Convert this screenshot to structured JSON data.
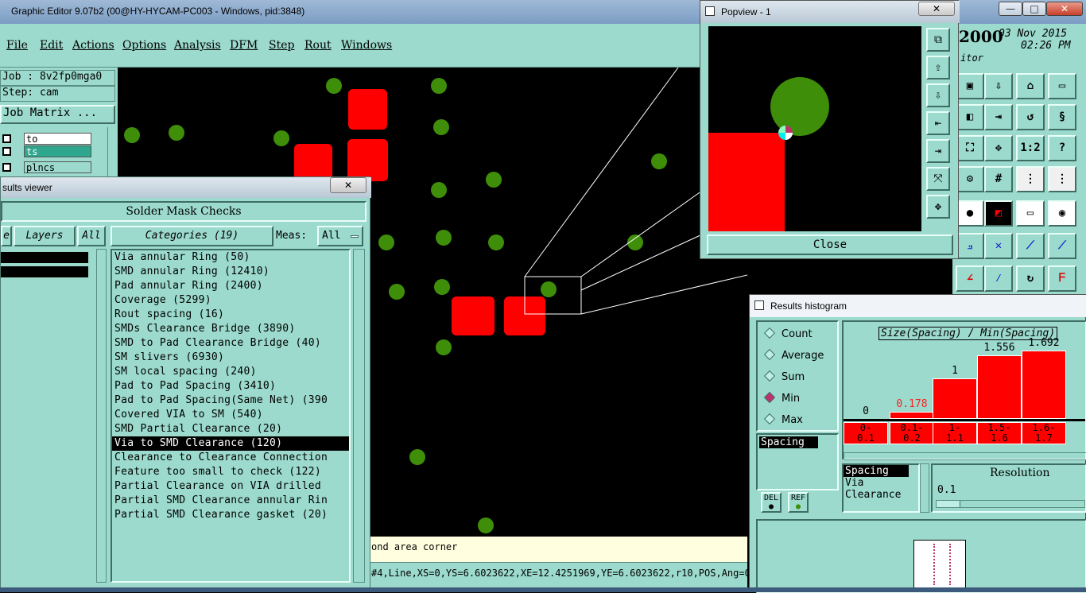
{
  "window": {
    "title": "Graphic Editor 9.07b2 (00@HY-HYCAM-PC003 - Windows, pid:3848)",
    "minimize": "—",
    "maximize": "□",
    "close": "✕"
  },
  "menu": [
    "File",
    "Edit",
    "Actions",
    "Options",
    "Analysis",
    "DFM",
    "Step",
    "Rout",
    "Windows"
  ],
  "info": {
    "job": "Job : 8v2fp0mga0",
    "step": "Step: cam",
    "job_matrix": "Job Matrix ..."
  },
  "layers": [
    "to",
    "ts",
    "plncs"
  ],
  "date_panel": {
    "year": "2000",
    "date": "03 Nov 2015",
    "time": "02:26 PM",
    "subtitle": "itor"
  },
  "results_viewer": {
    "title": "sults viewer",
    "close": "✕",
    "section_title": "Solder Mask Checks",
    "left_stub": "e",
    "layers_label": "Layers",
    "all_label": "All",
    "categories_label": "Categories (19)",
    "meas_label": "Meas:",
    "meas_value": "All",
    "categories": [
      "Via annular Ring (50)",
      "SMD annular Ring (12410)",
      "Pad annular Ring (2400)",
      "Coverage (5299)",
      "Rout spacing (16)",
      "SMDs Clearance Bridge (3890)",
      "SMD to Pad Clearance Bridge (40)",
      "SM slivers (6930)",
      "SM local spacing (240)",
      "Pad to Pad Spacing (3410)",
      "Pad to Pad Spacing(Same Net) (390",
      "Covered VIA to SM (540)",
      "SMD Partial Clearance (20)",
      "Via to SMD Clearance (120)",
      "Clearance to Clearance Connection",
      "Feature too small to check (122)",
      "Partial Clearance on VIA drilled",
      "Partial SMD Clearance annular Rin",
      "Partial SMD Clearance gasket (20)"
    ],
    "selected_index": 13
  },
  "status": {
    "message": "ond area corner",
    "coords": "#4,Line,XS=0,YS=6.6023622,XE=12.4251969,YE=6.6023622,r10,POS,Ang=0"
  },
  "popview": {
    "title": "Popview - 1",
    "close_x": "✕",
    "close_button": "Close"
  },
  "toolbar_icons": [
    "zoom-fit-icon",
    "zoom-in-icon",
    "zoom-out-icon",
    "pan-left-icon",
    "pan-right-icon",
    "center-icon",
    "fit-all-icon"
  ],
  "tools": {
    "ratio_label": "1:2",
    "help_label": "?"
  },
  "histogram": {
    "title": "Results histogram",
    "modes": [
      "Count",
      "Average",
      "Sum",
      "Min",
      "Max"
    ],
    "selected_mode": "Min",
    "chart_title": "Size(Spacing) / Min(Spacing)",
    "list_left": [
      "Spacing"
    ],
    "measures": [
      "Spacing",
      "Via",
      "Clearance"
    ],
    "resolution_label": "Resolution",
    "resolution_value": "0.1",
    "del_label": "DEL",
    "ref_label": "REF",
    "accent": "#ff0000",
    "highlight_value_color": "#ff2020"
  },
  "chart_data": {
    "type": "bar",
    "title": "Size(Spacing) / Min(Spacing)",
    "categories": [
      "0-\n0.1",
      "0.1-\n0.2",
      "1-\n1.1",
      "1.5-\n1.6",
      "1.6-\n1.7"
    ],
    "values": [
      0,
      0.178,
      1,
      1.556,
      1.692
    ],
    "value_labels": [
      "0",
      "0.178",
      "1",
      "1.556",
      "1.692"
    ],
    "ylim": [
      0,
      1.8
    ],
    "grid": false
  }
}
